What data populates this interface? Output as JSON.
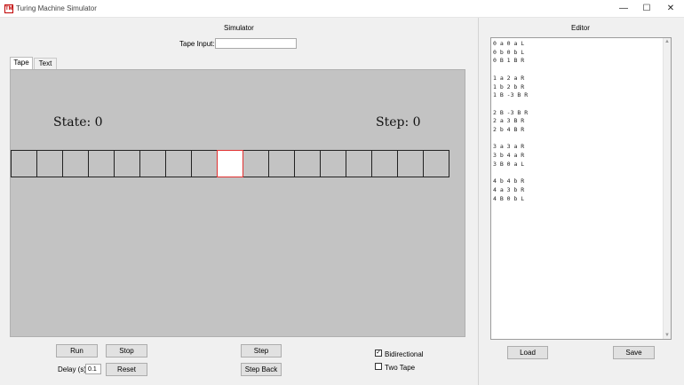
{
  "window": {
    "title": "Turing Machine Simulator",
    "icon": "TM",
    "controls": {
      "minimize": "—",
      "maximize": "☐",
      "close": "✕"
    }
  },
  "simulator": {
    "header": "Simulator",
    "tape_input_label": "Tape Input:",
    "tape_input_value": "",
    "tabs": [
      {
        "label": "Tape",
        "active": true
      },
      {
        "label": "Text",
        "active": false
      }
    ],
    "state_text": "State: 0",
    "step_text": "Step: 0",
    "tape_cells": [
      "",
      "",
      "",
      "",
      "",
      "",
      "",
      "",
      "",
      "",
      "",
      "",
      "",
      "",
      "",
      "",
      ""
    ],
    "head_index": 8,
    "buttons": {
      "run": "Run",
      "stop": "Stop",
      "reset": "Reset",
      "step": "Step",
      "step_back": "Step Back"
    },
    "delay_label": "Delay (s)",
    "delay_value": "0.1",
    "bidirectional": {
      "label": "Bidirectional",
      "checked": true
    },
    "two_tape": {
      "label": "Two Tape",
      "checked": false
    },
    "colors": {
      "canvas": "#c3c3c3",
      "head_border": "#e03030"
    }
  },
  "editor": {
    "header": "Editor",
    "content": "0 a 0 a L\n0 b 0 b L\n0 B 1 B R\n\n1 a 2 a R\n1 b 2 b R\n1 B -3 B R\n\n2 B -3 B R\n2 a 3 B R\n2 b 4 B R\n\n3 a 3 a R\n3 b 4 a R\n3 B 0 a L\n\n4 b 4 b R\n4 a 3 b R\n4 B 0 b L",
    "load_label": "Load",
    "save_label": "Save"
  }
}
